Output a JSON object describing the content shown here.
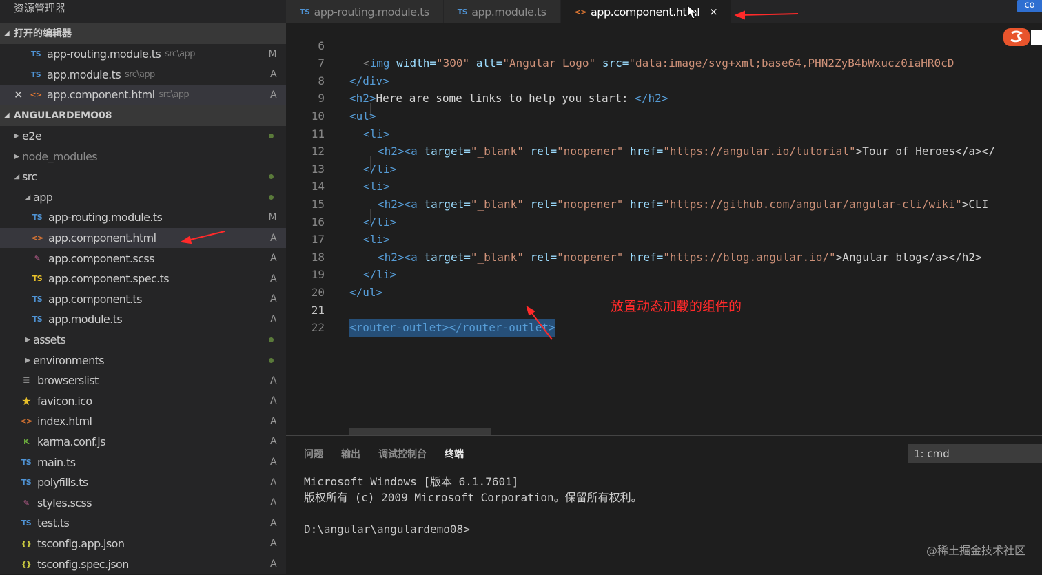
{
  "colors": {
    "sidebar_bg": "#252526",
    "editor_bg": "#1e1e1e",
    "tag": "#569cd6",
    "attr": "#9cdcfe",
    "string": "#ce9178",
    "annotation": "#ff2a2a"
  },
  "sidebar": {
    "title": "资源管理器",
    "open_editors": {
      "header": "打开的编辑器",
      "items": [
        {
          "icon": "TS",
          "name": "app-routing.module.ts",
          "path": "src\\app",
          "status": "M"
        },
        {
          "icon": "TS",
          "name": "app.module.ts",
          "path": "src\\app",
          "status": "A"
        },
        {
          "icon": "<>",
          "name": "app.component.html",
          "path": "src\\app",
          "status": "A"
        }
      ]
    },
    "project": {
      "header": "ANGULARDEMO08",
      "items": [
        {
          "name": "e2e",
          "status": ""
        },
        {
          "name": "node_modules",
          "status": ""
        },
        {
          "name": "src",
          "status": ""
        },
        {
          "name": "app",
          "status": ""
        },
        {
          "icon": "TS",
          "name": "app-routing.module.ts",
          "status": "M"
        },
        {
          "icon": "<>",
          "name": "app.component.html",
          "status": "A"
        },
        {
          "icon": "scss",
          "name": "app.component.scss",
          "status": "A"
        },
        {
          "icon": "TS",
          "name": "app.component.spec.ts",
          "status": "A"
        },
        {
          "icon": "TS",
          "name": "app.component.ts",
          "status": "A"
        },
        {
          "icon": "TS",
          "name": "app.module.ts",
          "status": "A"
        },
        {
          "name": "assets",
          "status": ""
        },
        {
          "name": "environments",
          "status": ""
        },
        {
          "icon": "list",
          "name": "browserslist",
          "status": "A"
        },
        {
          "icon": "star",
          "name": "favicon.ico",
          "status": "A"
        },
        {
          "icon": "<>",
          "name": "index.html",
          "status": "A"
        },
        {
          "icon": "karma",
          "name": "karma.conf.js",
          "status": "A"
        },
        {
          "icon": "TS",
          "name": "main.ts",
          "status": "A"
        },
        {
          "icon": "TS",
          "name": "polyfills.ts",
          "status": "A"
        },
        {
          "icon": "scss",
          "name": "styles.scss",
          "status": "A"
        },
        {
          "icon": "TS",
          "name": "test.ts",
          "status": "A"
        },
        {
          "icon": "{}",
          "name": "tsconfig.app.json",
          "status": "A"
        },
        {
          "icon": "{}",
          "name": "tsconfig.spec.json",
          "status": "A"
        }
      ]
    }
  },
  "tabs": [
    {
      "icon": "TS",
      "label": "app-routing.module.ts"
    },
    {
      "icon": "TS",
      "label": "app.module.ts"
    },
    {
      "icon": "<>",
      "label": "app.component.html",
      "close": "×"
    }
  ],
  "top_badge": "co",
  "editor": {
    "line_numbers": [
      "6",
      "7",
      "8",
      "9",
      "10",
      "11",
      "12",
      "13",
      "14",
      "15",
      "16",
      "17",
      "18",
      "19",
      "20",
      "21",
      "22"
    ],
    "l6": {
      "a": "<",
      "b": "img",
      "c": " width=",
      "d": "\"300\"",
      "e": " alt=",
      "f": "\"Angular Logo\"",
      "g": " src=",
      "h": "\"data:image/svg+xml;base64,PHN2ZyB4bWxucz0iaHR0cD"
    },
    "l7": "</div>",
    "l8": {
      "open": "<h2>",
      "text": "Here are some links to help you start: ",
      "close": "</h2>"
    },
    "l9": "<ul>",
    "li_open": "<li>",
    "li_close": "</li>",
    "h2a": "<h2><a",
    "target": " target=",
    "blank": "\"_blank\"",
    "rel": " rel=",
    "noopener": "\"noopener\"",
    "href": " href=",
    "l11": {
      "url": "\"https://angular.io/tutorial\"",
      "rest": ">Tour of Heroes</a></"
    },
    "l14": {
      "url": "\"https://github.com/angular/angular-cli/wiki\"",
      "rest": ">CLI"
    },
    "l17": {
      "url": "\"https://blog.angular.io/\"",
      "rest": ">Angular blog</a></h2>"
    },
    "l19": "</ul>",
    "l21": "<router-outlet></router-outlet>"
  },
  "annotation": "放置动态加载的组件的",
  "panel": {
    "tabs": [
      "问题",
      "输出",
      "调试控制台",
      "终端"
    ],
    "terminal_select": "1: cmd",
    "terminal_lines": [
      "Microsoft Windows [版本 6.1.7601]",
      "版权所有 (c) 2009 Microsoft Corporation。保留所有权利。",
      "",
      "D:\\angular\\angulardemo08>"
    ]
  },
  "watermark": "@稀土掘金技术社区"
}
